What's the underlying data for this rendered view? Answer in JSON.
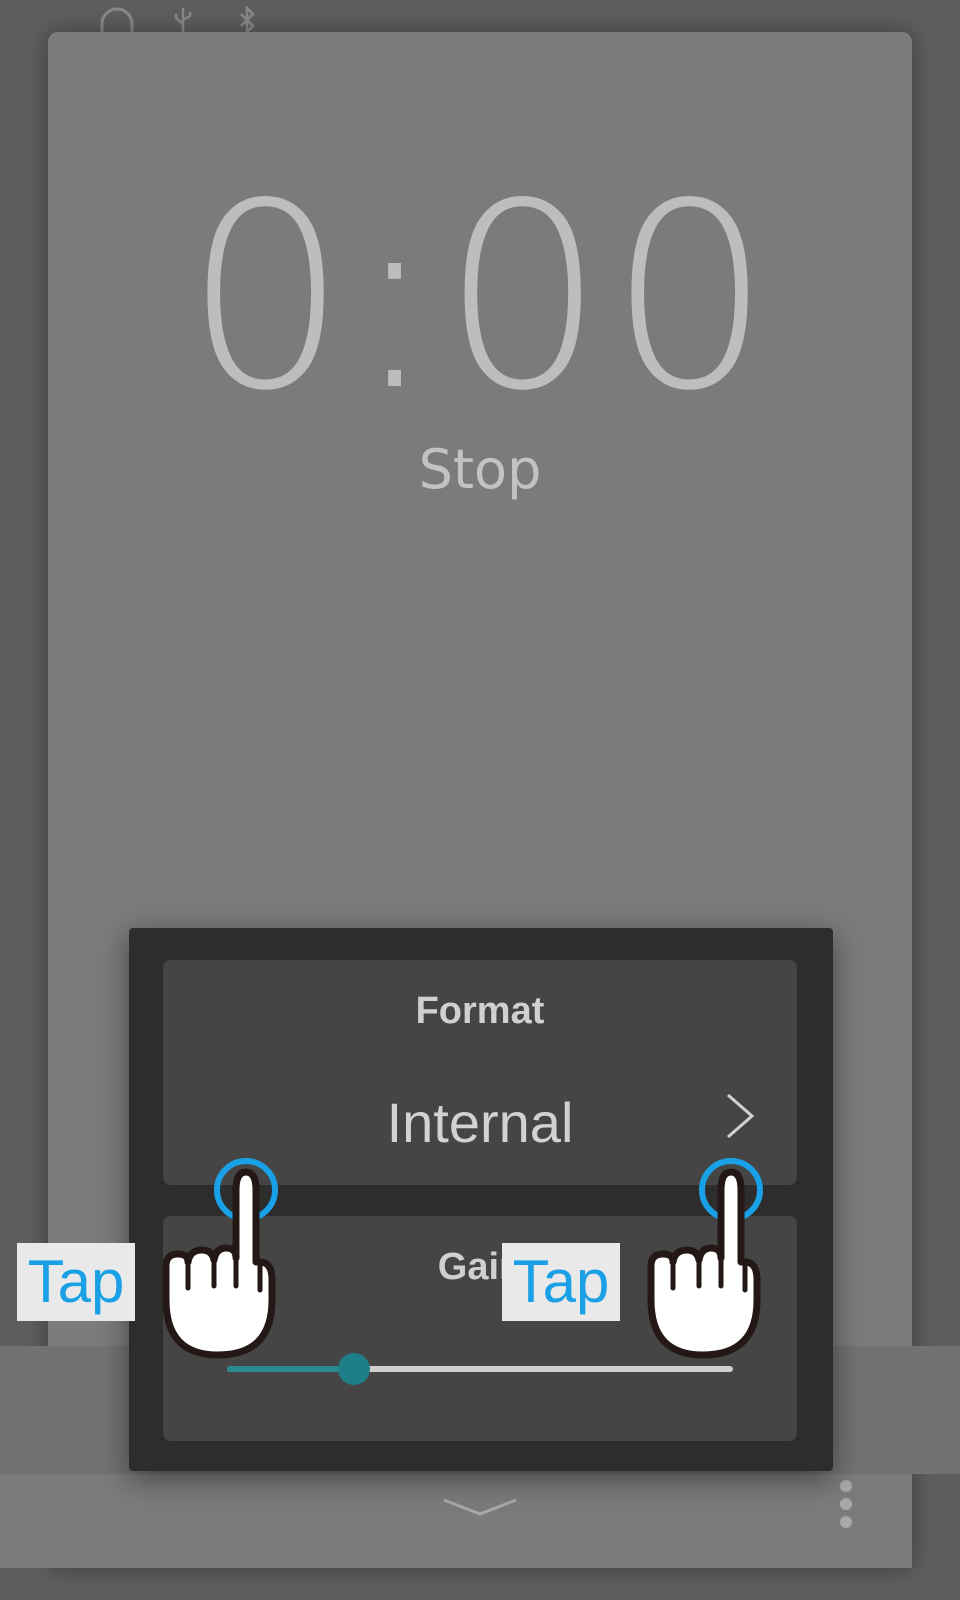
{
  "status_icons": [
    "headphone-icon",
    "usb-icon",
    "bluetooth-icon"
  ],
  "recorder": {
    "time": "0:00",
    "state": "Stop"
  },
  "dialog": {
    "format": {
      "title": "Format",
      "value": "Internal"
    },
    "gain": {
      "title": "Gain",
      "level": 0.25
    }
  },
  "annotations": {
    "left_tap": "Tap",
    "right_tap": "Tap"
  },
  "colors": {
    "tap_text": "#1aa0e6",
    "tap_ring": "#1aa0e6",
    "slider_accent": "#1f7f89"
  },
  "bottom_bar": {
    "collapse_icon": "chevron-down-icon",
    "menu_icon": "more-vertical-icon"
  }
}
